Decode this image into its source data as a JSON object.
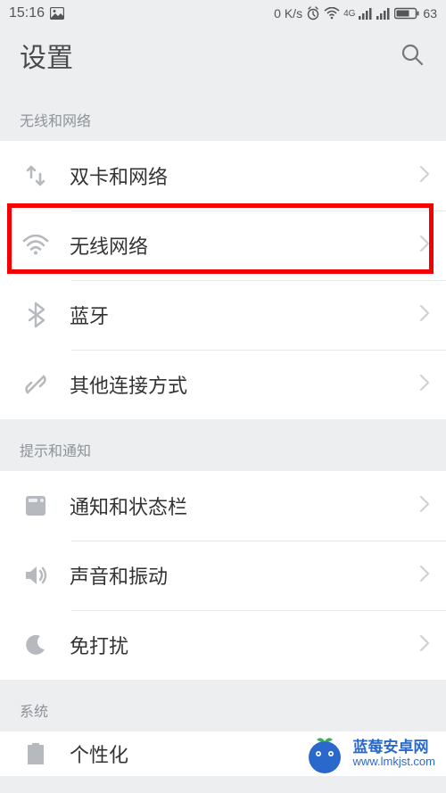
{
  "status": {
    "time": "15:16",
    "speed": "0 K/s",
    "network_type": "4G",
    "battery": "63"
  },
  "header": {
    "title": "设置"
  },
  "sections": [
    {
      "title": "无线和网络",
      "items": [
        {
          "icon": "sim-icon",
          "label": "双卡和网络"
        },
        {
          "icon": "wifi-icon",
          "label": "无线网络",
          "highlighted": true
        },
        {
          "icon": "bluetooth-icon",
          "label": "蓝牙"
        },
        {
          "icon": "link-icon",
          "label": "其他连接方式"
        }
      ]
    },
    {
      "title": "提示和通知",
      "items": [
        {
          "icon": "notify-icon",
          "label": "通知和状态栏"
        },
        {
          "icon": "sound-icon",
          "label": "声音和振动"
        },
        {
          "icon": "dnd-icon",
          "label": "免打扰"
        }
      ]
    },
    {
      "title": "系统",
      "items": [
        {
          "icon": "theme-icon",
          "label": "个性化"
        }
      ]
    }
  ],
  "watermark": {
    "title": "蓝莓安卓网",
    "url": "www.lmkjst.com"
  }
}
